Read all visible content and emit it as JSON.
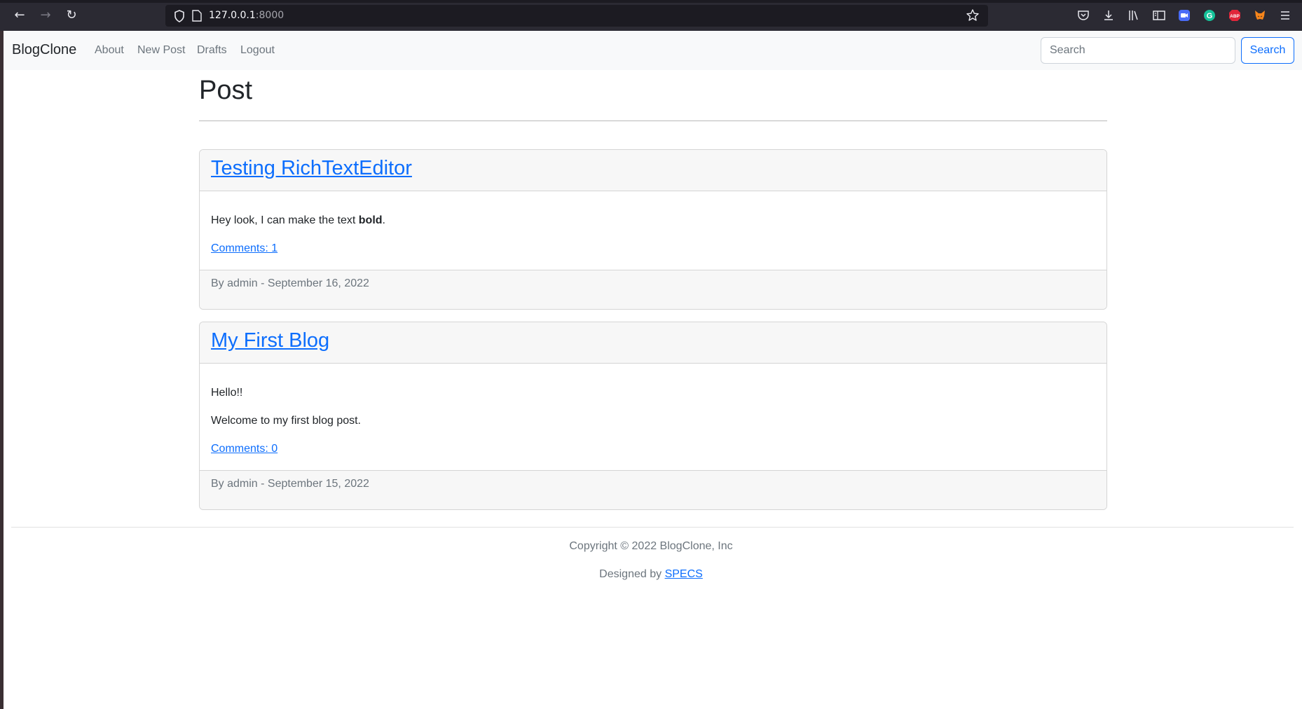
{
  "browser": {
    "url_host": "127.0.0.1",
    "url_port": ":8000"
  },
  "navbar": {
    "brand": "BlogClone",
    "links": [
      "About",
      "New Post",
      "Drafts",
      "Logout"
    ],
    "search_placeholder": "Search",
    "search_button": "Search"
  },
  "main": {
    "title": "Post",
    "posts": [
      {
        "title": "Testing RichTextEditor",
        "body_prefix": "Hey look, I can make the text ",
        "body_bold": "bold",
        "body_suffix": ".",
        "comments": "Comments: 1",
        "meta": "By admin - September 16, 2022"
      },
      {
        "title": "My First Blog",
        "line1": "Hello!!",
        "line2": "Welcome to my first blog post.",
        "comments": "Comments: 0",
        "meta": "By admin - September 15, 2022"
      }
    ]
  },
  "footer": {
    "copyright": "Copyright © 2022 BlogClone, Inc",
    "designed_prefix": "Designed by ",
    "designed_link": "SPECS"
  },
  "colors": {
    "accent": "#0d6efd",
    "muted": "#6c757d",
    "chrome_bg": "#2b2a33"
  }
}
